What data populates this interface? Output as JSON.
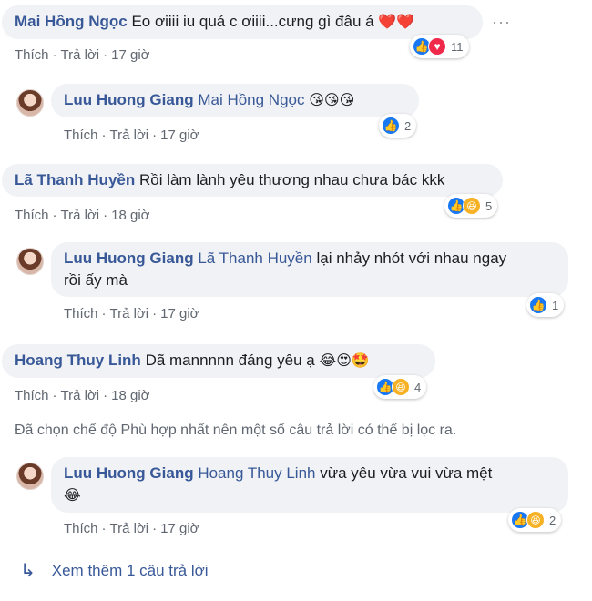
{
  "comments": [
    {
      "author": "Mai Hồng Ngọc",
      "text": "Eo ơiiii iu quá c ơiiii...cưng gì đâu á",
      "emoji": "❤️❤️",
      "like": "Thích",
      "reply": "Trả lời",
      "time": "17 giờ",
      "reaction_count": "11",
      "more": "···"
    },
    {
      "author": "Luu Huong Giang",
      "mention": "Mai Hồng Ngọc",
      "emoji": "😘😘😘",
      "like": "Thích",
      "reply": "Trả lời",
      "time": "17 giờ",
      "reaction_count": "2"
    },
    {
      "author": "Lã Thanh Huyền",
      "text": "Rồi làm lành yêu thương nhau chưa bác kkk",
      "like": "Thích",
      "reply": "Trả lời",
      "time": "18 giờ",
      "reaction_count": "5"
    },
    {
      "author": "Luu Huong Giang",
      "mention": "Lã Thanh Huyền",
      "text_line1": "lại nhảy nhót với nhau ngay",
      "text_line2": "rồi ấy mà",
      "like": "Thích",
      "reply": "Trả lời",
      "time": "17 giờ",
      "reaction_count": "1"
    },
    {
      "author": "Hoang Thuy Linh",
      "text": "Dã mannnnn đáng yêu ạ",
      "emoji": "😂😍🤩",
      "like": "Thích",
      "reply": "Trả lời",
      "time": "18 giờ",
      "reaction_count": "4"
    },
    {
      "author": "Luu Huong Giang",
      "mention": "Hoang Thuy Linh",
      "text_line1": "vừa yêu vừa vui vừa mệt",
      "emoji": "😂",
      "like": "Thích",
      "reply": "Trả lời",
      "time": "17 giờ",
      "reaction_count": "2"
    }
  ],
  "filter_note": "Đã chọn chế độ Phù hợp nhất nên một số câu trả lời có thể bị lọc ra.",
  "more_replies": "Xem thêm 1 câu trả lời",
  "colors": {
    "author": "#385898",
    "bubble": "#f0f2f5",
    "like": "#1877f2",
    "love": "#f0284a",
    "haha": "#f7b125"
  }
}
